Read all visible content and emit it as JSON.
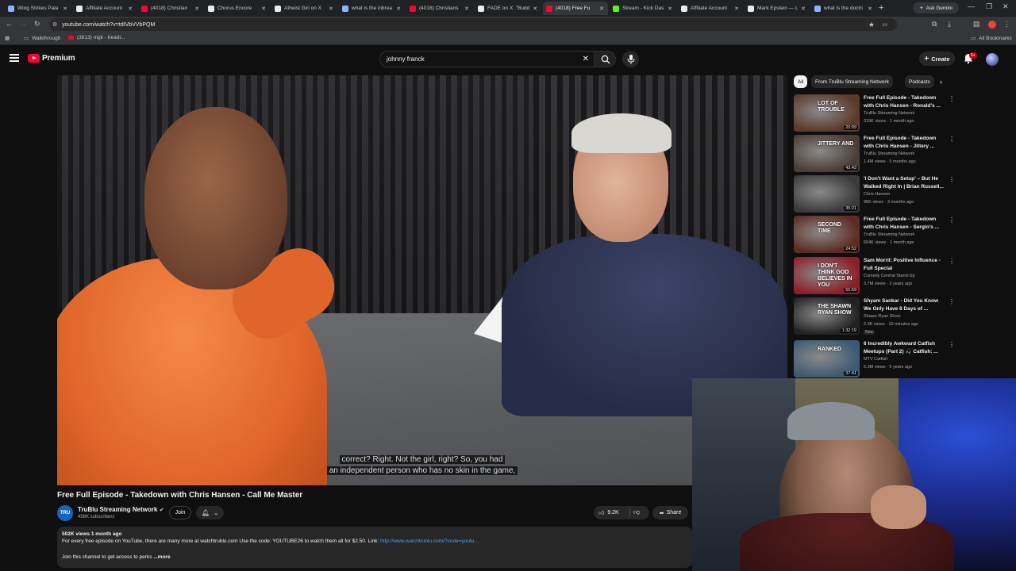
{
  "browser": {
    "tabs": [
      {
        "title": "Wing Strikes Pala",
        "color": "#8ab4f8",
        "active": false
      },
      {
        "title": "Affiliate Account",
        "color": "#e8eaed",
        "active": false
      },
      {
        "title": "(4018) Christian",
        "color": "#ff0033",
        "active": false
      },
      {
        "title": "Chorus Encore",
        "color": "#e8eaed",
        "active": false
      },
      {
        "title": "Atheist Girl on X",
        "color": "#e8eaed",
        "active": false
      },
      {
        "title": "what is the inbrea",
        "color": "#8ab4f8",
        "active": false
      },
      {
        "title": "(4018) Christians",
        "color": "#ff0033",
        "active": false
      },
      {
        "title": "FADE on X: \"Budd",
        "color": "#e8eaed",
        "active": false
      },
      {
        "title": "(4018) Free Fu",
        "color": "#ff0033",
        "active": true
      },
      {
        "title": "Stream - Kick Das",
        "color": "#53fc18",
        "active": false
      },
      {
        "title": "Affiliate Account",
        "color": "#e8eaed",
        "active": false
      },
      {
        "title": "Mark Epstein — L",
        "color": "#e8eaed",
        "active": false
      },
      {
        "title": "what is the doctri",
        "color": "#8ab4f8",
        "active": false
      }
    ],
    "ask_gemini": "Ask Gemini",
    "url": "youtube.com/watch?v=tdIVbVVbPQM",
    "bookmarks": [
      {
        "label": "Walkthrough"
      },
      {
        "label": "(3813) mgk - treadi..."
      }
    ],
    "all_bookmarks": "All Bookmarks"
  },
  "youtube": {
    "brand": "Premium",
    "search_value": "johnny franck",
    "create_label": "Create",
    "notif_count": "9+",
    "video": {
      "title": "Free Full Episode - Takedown with Chris Hansen - Call Me Master",
      "caption_line1": "correct? Right. Not the girl, right? So, you had",
      "caption_line2": "an independent person who has no skin in the game,",
      "channel_avatar_text": "TRU",
      "channel": "TruBlu Streaming Network",
      "subs": "456K subscribers",
      "join": "Join",
      "likes": "9.2K",
      "share": "Share",
      "desc_meta": "502K views  1 month ago",
      "desc_line": "For every free episode on YouTube, there are many more at watchtrublu.com  Use the code: YOUTUBE26 to watch them all for $2.50.  Link:",
      "desc_link": "http://www.watchtrublu.com/?code=youtu...",
      "desc_line2": "Join this channel to get access to perks",
      "desc_more": "...more"
    },
    "chips": [
      "All",
      "From TruBlu Streaming Network",
      "Podcasts"
    ],
    "recommendations": [
      {
        "title": "Free Full Episode - Takedown with Chris Hansen - Ronald's ...",
        "channel": "TruBlu Streaming Network",
        "meta": "319K views · 1 month ago",
        "duration": "20:09",
        "thumb_text": "LOT OF TROUBLE",
        "thumb_color": "#5a3a2a",
        "badge": ""
      },
      {
        "title": "Free Full Episode - Takedown with Chris Hansen - Jittery ...",
        "channel": "TruBlu Streaming Network",
        "meta": "1.4M views · 5 months ago",
        "duration": "43:43",
        "thumb_text": "JITTERY AND",
        "thumb_color": "#4a3c36",
        "badge": ""
      },
      {
        "title": "'I Don't Want a Setup' – But He Walked Right In | Brian Russell...",
        "channel": "Chris Hansen",
        "meta": "96K views · 3 months ago",
        "duration": "35:21",
        "thumb_text": "",
        "thumb_color": "#3a3a3a",
        "badge": ""
      },
      {
        "title": "Free Full Episode - Takedown with Chris Hansen - Sergio's ...",
        "channel": "TruBlu Streaming Network",
        "meta": "504K views · 1 month ago",
        "duration": "24:52",
        "thumb_text": "SECOND TIME",
        "thumb_color": "#5c2b22",
        "badge": ""
      },
      {
        "title": "Sam Morril: Positive Influence - Full Special",
        "channel": "Comedy Central Stand-Up",
        "meta": "3.7M views · 3 years ago",
        "duration": "55:59",
        "thumb_text": "I DON'T THINK GOD BELIEVES IN YOU",
        "thumb_color": "#8c1f2a",
        "badge": ""
      },
      {
        "title": "Shyam Sankar - Did You Know We Only Have 8 Days of ...",
        "channel": "Shawn Ryan Show",
        "meta": "2.3K views · 10 minutes ago",
        "duration": "1:32:19",
        "thumb_text": "THE SHAWN RYAN SHOW",
        "thumb_color": "#222",
        "badge": "New"
      },
      {
        "title": "6 Incredibly Awkward Catfish Meetups (Part 2) 🎣 Catfish: ...",
        "channel": "MTV Catfish",
        "meta": "5.3M views · 5 years ago",
        "duration": "37:41",
        "thumb_text": "RANKED",
        "thumb_color": "#3d5a74",
        "badge": ""
      }
    ]
  }
}
